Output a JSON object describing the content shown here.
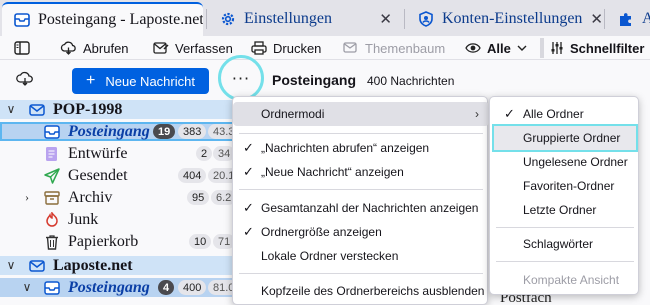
{
  "tabs": [
    {
      "label": "Posteingang - Laposte.net",
      "icon": "mail-icon",
      "active": true
    },
    {
      "label": "Einstellungen",
      "icon": "gear-icon",
      "active": false
    },
    {
      "label": "Konten-Einstellungen",
      "icon": "account-icon",
      "active": false
    },
    {
      "label": "Ad",
      "icon": "puzzle-icon",
      "active": false
    }
  ],
  "toolbar": {
    "get_messages": "Abrufen",
    "compose": "Verfassen",
    "print": "Drucken",
    "threads": "Themenbaum",
    "filter_all": "Alle",
    "quick_filter": "Schnellfilter"
  },
  "header": {
    "new_message": "Neue Nachricht",
    "more": "···",
    "folder_title": "Posteingang",
    "message_count": "400 Nachrichten"
  },
  "tree": {
    "account1": {
      "name": "POP-1998"
    },
    "inbox1": {
      "name": "Posteingang",
      "unread": "19",
      "total": "383",
      "size": "43.3"
    },
    "drafts": {
      "name": "Entwürfe",
      "total": "2",
      "size": "34"
    },
    "sent": {
      "name": "Gesendet",
      "total": "404",
      "size": "20.1"
    },
    "archive": {
      "name": "Archiv",
      "total": "95",
      "size": "6.2"
    },
    "junk": {
      "name": "Junk"
    },
    "trash": {
      "name": "Papierkorb",
      "total": "10",
      "size": "71"
    },
    "account2": {
      "name": "Laposte.net"
    },
    "inbox2": {
      "name": "Posteingang",
      "unread": "4",
      "total": "400",
      "size": "81.0"
    }
  },
  "behind_text": "Postfach",
  "menu1": {
    "folder_modes": "Ordnermodi",
    "show_get_messages": "„Nachrichten abrufen“ anzeigen",
    "show_new_message": "„Neue Nachricht“ anzeigen",
    "show_total_count": "Gesamtanzahl der Nachrichten anzeigen",
    "show_folder_size": "Ordnergröße anzeigen",
    "hide_local_folders": "Lokale Ordner verstecken",
    "hide_header": "Kopfzeile des Ordnerbereichs ausblenden"
  },
  "menu2": {
    "all_folders": "Alle Ordner",
    "grouped_folders": "Gruppierte Ordner",
    "unread_folders": "Ungelesene Ordner",
    "favorite_folders": "Favoriten-Ordner",
    "recent_folders": "Letzte Ordner",
    "tags": "Schlagwörter",
    "compact_view": "Kompakte Ansicht"
  },
  "colors": {
    "accent": "#0061e0",
    "highlight": "#74e0ea",
    "selected_row": "#cfe3f7"
  }
}
